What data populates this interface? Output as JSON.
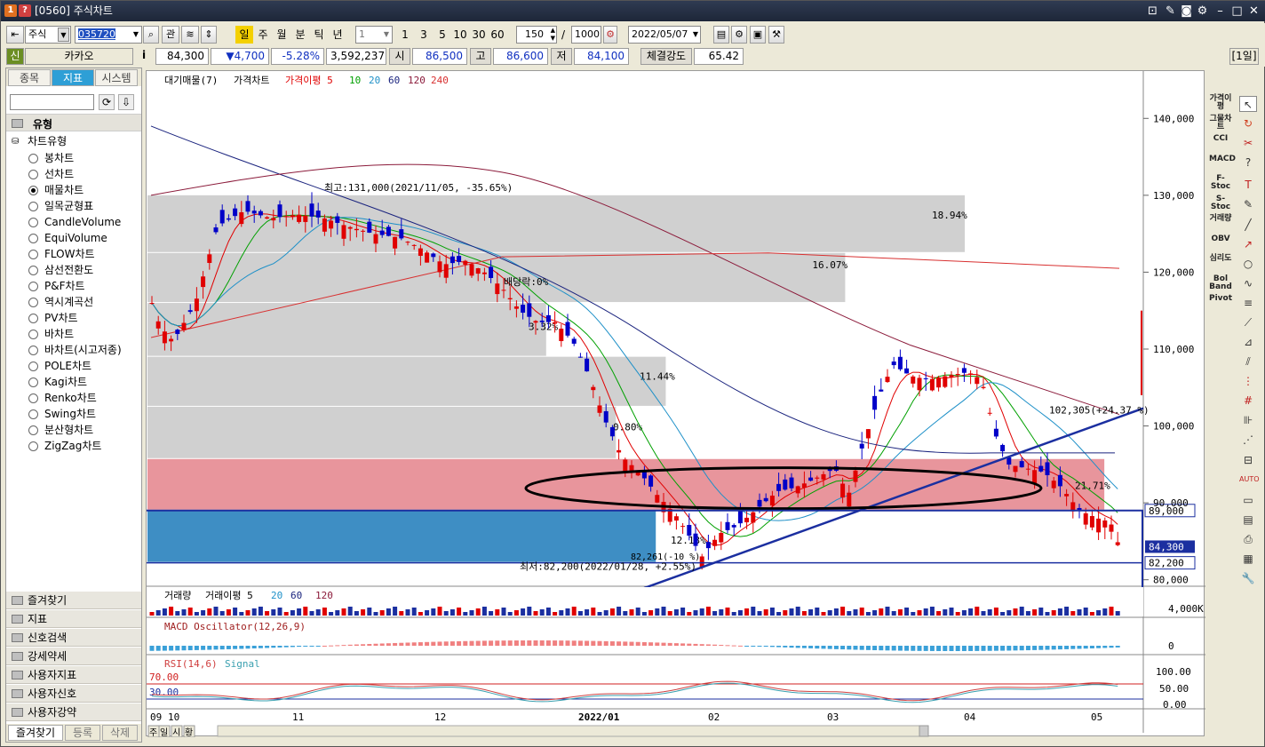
{
  "window": {
    "title": "[0560] 주식차트",
    "icon1": "1",
    "icon2": "?"
  },
  "toolbar": {
    "market": "주식",
    "code": "035720",
    "btn_gwan": "관",
    "periods": [
      "일",
      "주",
      "월",
      "분",
      "틱",
      "년"
    ],
    "active_period": "일",
    "minute_select": "1",
    "intervals": [
      "1",
      "3",
      "5",
      "10",
      "30",
      "60"
    ],
    "count": "150",
    "slash": "/",
    "total": "1000",
    "date": "2022/05/07"
  },
  "quote": {
    "badge": "신",
    "name": "카카오",
    "info": "i",
    "price": "84,300",
    "change": "▼4,700",
    "change_pct": "-5.28%",
    "volume": "3,592,237",
    "open_label": "시",
    "open": "86,500",
    "high_label": "고",
    "high": "86,600",
    "low_label": "저",
    "low": "84,100",
    "strength_label": "체결강도",
    "strength": "65.42",
    "period_tag": "[1일]"
  },
  "left_panel": {
    "tabs": [
      "종목",
      "지표",
      "시스템"
    ],
    "active_tab": "지표",
    "section": "유형",
    "group": "차트유형",
    "items": [
      "봉차트",
      "선차트",
      "매물차트",
      "일목균형표",
      "CandleVolume",
      "EquiVolume",
      "FLOW차트",
      "삼선전환도",
      "P&F차트",
      "역시계곡선",
      "PV차트",
      "바차트",
      "바차트(시고저종)",
      "POLE차트",
      "Kagi차트",
      "Renko차트",
      "Swing차트",
      "분산형차트",
      "ZigZag차트"
    ],
    "selected": "매물차트",
    "folders": [
      "즐겨찾기",
      "지표",
      "신호검색",
      "강세약세",
      "사용자지표",
      "사용자신호",
      "사용자강약"
    ],
    "bottom_tabs": [
      "즐겨찾기",
      "등록",
      "삭제"
    ]
  },
  "chart": {
    "legend_main": [
      "대기매물(7)",
      "가격차트",
      "가격이평 5",
      "10",
      "20",
      "60",
      "120",
      "240"
    ],
    "legend_colors": {
      "p5": "#e00000",
      "p10": "#00a000",
      "p20": "#1e90c8",
      "p60": "#1a237e",
      "p120": "#8b1a3a",
      "p240": "#d83030"
    },
    "price_axis": [
      "140,000",
      "130,000",
      "120,000",
      "110,000",
      "100,000",
      "90,000",
      "80,000"
    ],
    "annotations": {
      "high": "최고:131,000(2021/11/05, -35.65%)",
      "low": "최저:82,200(2022/01/28, +2.55%)",
      "dividend": "배당락:0%",
      "trend_value": "102,305(+24.37 %)",
      "small_low": "82,261(-10 %)",
      "cur_price": "84,300",
      "ref_price": "89,000",
      "low_tag": "82,200"
    },
    "volume_profile_pct": [
      "18.94%",
      "16.07%",
      "3.32%",
      "11.44%",
      "0.80%",
      "21.71%",
      "12.13%"
    ],
    "volume_legend": [
      "거래량",
      "거래이평 5",
      "20",
      "60",
      "120"
    ],
    "volume_axis": "4,000K",
    "macd_legend": "MACD Oscillator(12,26,9)",
    "macd_axis": "0",
    "rsi_legend": [
      "RSI(14,6)",
      "Signal"
    ],
    "rsi_levels": [
      "70.00",
      "30.00"
    ],
    "rsi_axis": [
      "100.00",
      "50.00",
      "0.00"
    ],
    "x_axis": [
      "09",
      "10",
      "11",
      "12",
      "2022/01",
      "02",
      "03",
      "04",
      "05"
    ],
    "bottom_buttons": [
      "주",
      "일",
      "시",
      "황"
    ]
  },
  "right_tools": [
    "가격이평",
    "그물차트",
    "CCI",
    "MACD",
    "F-Stoc",
    "S-Stoc",
    "거래량",
    "OBV",
    "심리도",
    "Bol Band",
    "Pivot"
  ],
  "chart_data": {
    "type": "candlestick",
    "title": "",
    "x": [
      "2021-09",
      "2021-10",
      "2021-11",
      "2021-12",
      "2022-01",
      "2022-02",
      "2022-03",
      "2022-04",
      "2022-05"
    ],
    "close_approx": [
      118000,
      112000,
      126000,
      120000,
      92000,
      86000,
      95000,
      103000,
      84300
    ],
    "ylim": [
      78000,
      145000
    ],
    "series": [
      {
        "name": "가격이평 5",
        "color": "#e00000"
      },
      {
        "name": "10",
        "color": "#00a000"
      },
      {
        "name": "20",
        "color": "#1e90c8"
      },
      {
        "name": "60",
        "color": "#1a237e"
      },
      {
        "name": "120",
        "color": "#8b1a3a"
      },
      {
        "name": "240",
        "color": "#d83030"
      }
    ]
  }
}
